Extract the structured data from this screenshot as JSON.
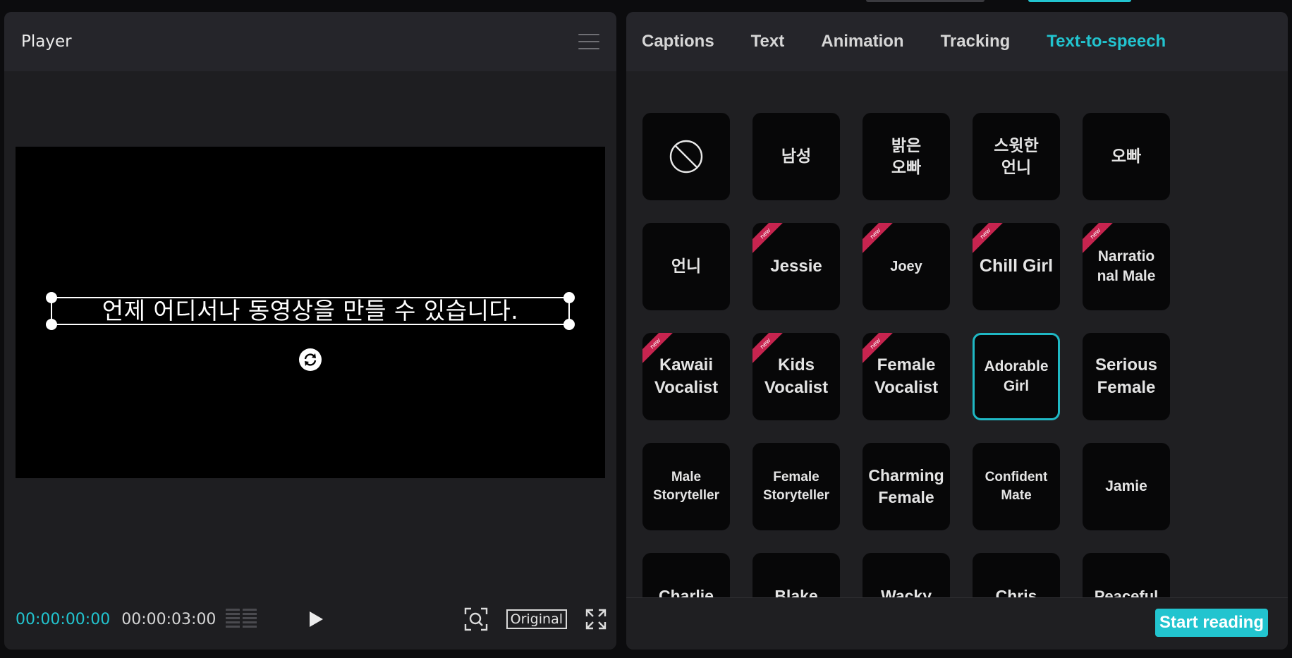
{
  "player": {
    "title": "Player",
    "caption": "언제 어디서나 동영상을 만들 수 있습니다.",
    "time_current": "00:00:00:00",
    "time_total": "00:00:03:00",
    "original_label": "Original"
  },
  "tabs": [
    {
      "label": "Captions",
      "active": false
    },
    {
      "label": "Text",
      "active": false
    },
    {
      "label": "Animation",
      "active": false
    },
    {
      "label": "Tracking",
      "active": false
    },
    {
      "label": "Text-to-speech",
      "active": true
    }
  ],
  "voices": [
    {
      "label": "",
      "icon": "no-voice-icon",
      "new": false,
      "selected": false,
      "size": 23
    },
    {
      "label": "남성",
      "new": false,
      "selected": false,
      "size": 23
    },
    {
      "label": "밝은\n오빠",
      "new": false,
      "selected": false,
      "size": 23
    },
    {
      "label": "스윗한\n언니",
      "new": false,
      "selected": false,
      "size": 23
    },
    {
      "label": "오빠",
      "new": false,
      "selected": false,
      "size": 23
    },
    {
      "label": "언니",
      "new": false,
      "selected": false,
      "size": 23
    },
    {
      "label": "Jessie",
      "new": true,
      "selected": false,
      "size": 24
    },
    {
      "label": "Joey",
      "new": true,
      "selected": false,
      "size": 20
    },
    {
      "label": "Chill Girl",
      "new": true,
      "selected": false,
      "size": 25
    },
    {
      "label": "Narratio\nnal Male",
      "new": true,
      "selected": false,
      "size": 21
    },
    {
      "label": "Kawaii\nVocalist",
      "new": true,
      "selected": false,
      "size": 24
    },
    {
      "label": "Kids\nVocalist",
      "new": true,
      "selected": false,
      "size": 24
    },
    {
      "label": "Female\nVocalist",
      "new": true,
      "selected": false,
      "size": 24
    },
    {
      "label": "Adorable\nGirl",
      "new": false,
      "selected": true,
      "size": 21
    },
    {
      "label": "Serious\nFemale",
      "new": false,
      "selected": false,
      "size": 24
    },
    {
      "label": "Male\nStoryteller",
      "new": false,
      "selected": false,
      "size": 19
    },
    {
      "label": "Female\nStoryteller",
      "new": false,
      "selected": false,
      "size": 19
    },
    {
      "label": "Charming\nFemale",
      "new": false,
      "selected": false,
      "size": 23
    },
    {
      "label": "Confident\nMate",
      "new": false,
      "selected": false,
      "size": 19
    },
    {
      "label": "Jamie",
      "new": false,
      "selected": false,
      "size": 21
    },
    {
      "label": "Charlie",
      "new": false,
      "selected": false,
      "size": 23
    },
    {
      "label": "Blake",
      "new": false,
      "selected": false,
      "size": 23
    },
    {
      "label": "Wacky",
      "new": false,
      "selected": false,
      "size": 23
    },
    {
      "label": "Chris",
      "new": false,
      "selected": false,
      "size": 23
    },
    {
      "label": "Peaceful",
      "new": false,
      "selected": false,
      "size": 22
    }
  ],
  "new_badge": "new",
  "footer": {
    "start_label": "Start reading"
  },
  "colors": {
    "accent": "#22c4cf",
    "badge": "#c7244f"
  }
}
